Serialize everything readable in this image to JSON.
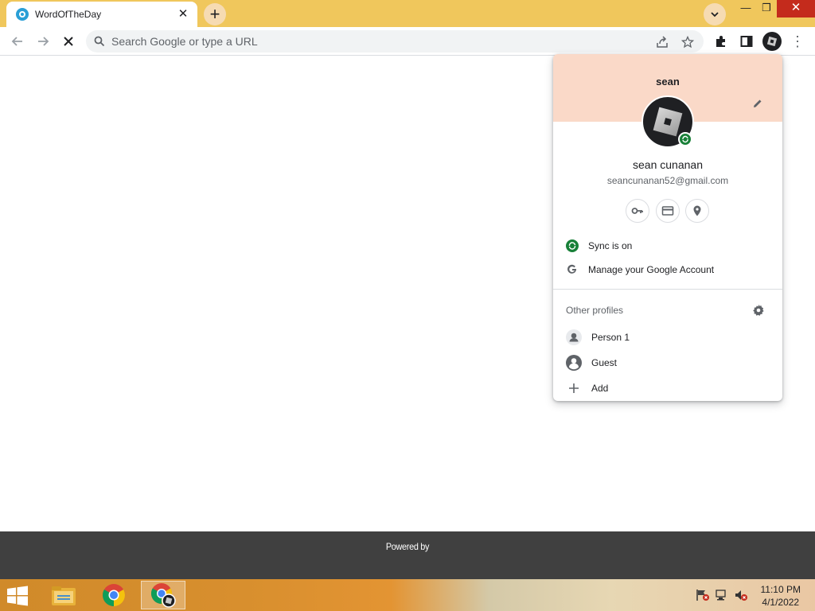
{
  "browser": {
    "tab": {
      "title": "WordOfTheDay",
      "close_glyph": "✕",
      "favicon": "wordoftheday-favicon"
    },
    "new_tab_glyph": "+",
    "window_controls": {
      "minimize": "—",
      "maximize": "❐",
      "close": "✕"
    },
    "toolbar": {
      "back_glyph": "←",
      "forward_glyph": "→",
      "stop_glyph": "✕",
      "omnibox_placeholder": "Search Google or type a URL",
      "menu_glyph": "⋮"
    },
    "accent_color": "#f0c75c"
  },
  "profile_menu": {
    "short_name": "sean",
    "full_name": "sean cunanan",
    "email": "seancunanan52@gmail.com",
    "quick_actions": [
      "key-icon",
      "credit-card-icon",
      "location-pin-icon"
    ],
    "sync_label": "Sync is on",
    "manage_label": "Manage your Google Account",
    "other_profiles_label": "Other profiles",
    "profiles": [
      {
        "label": "Person 1",
        "icon": "person-icon"
      },
      {
        "label": "Guest",
        "icon": "guest-icon"
      },
      {
        "label": "Add",
        "icon": "plus-icon"
      }
    ],
    "header_color": "#fad9c8"
  },
  "page": {
    "footer_text": "Powered by"
  },
  "taskbar": {
    "apps": [
      "file-explorer-icon",
      "chrome-icon",
      "chrome-profile-icon"
    ],
    "time": "11:10 PM",
    "date": "4/1/2022"
  }
}
